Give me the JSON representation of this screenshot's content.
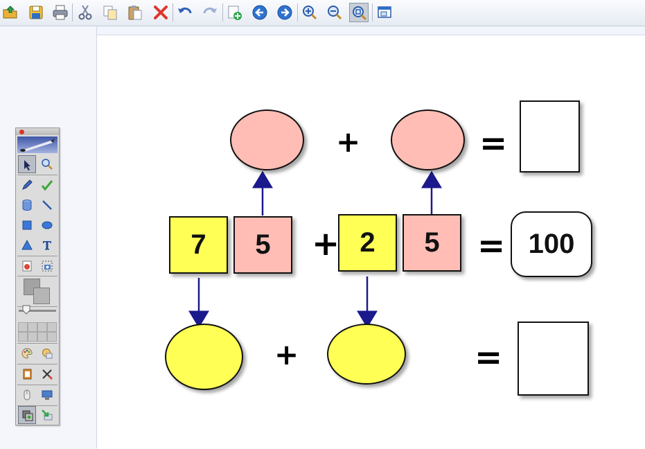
{
  "toolbar": {
    "icons": [
      "open-icon",
      "save-icon",
      "print-icon",
      "cut-icon",
      "copy-icon",
      "paste-icon",
      "delete-icon",
      "undo-icon",
      "redo-icon",
      "new-page-icon",
      "back-icon",
      "forward-icon",
      "zoom-in-icon",
      "zoom-out-icon",
      "zoom-fit-icon",
      "window-icon"
    ]
  },
  "puzzle": {
    "row1": {
      "plus": "+",
      "equals": "="
    },
    "row2": {
      "d1": "7",
      "d2": "5",
      "plus": "+",
      "d3": "2",
      "d4": "5",
      "equals": "=",
      "total": "100"
    },
    "row3": {
      "plus": "+",
      "equals": "="
    }
  },
  "colors": {
    "yellow": "#ffff55",
    "pink": "#ffbdb5",
    "arrow": "#1a1a8c"
  }
}
